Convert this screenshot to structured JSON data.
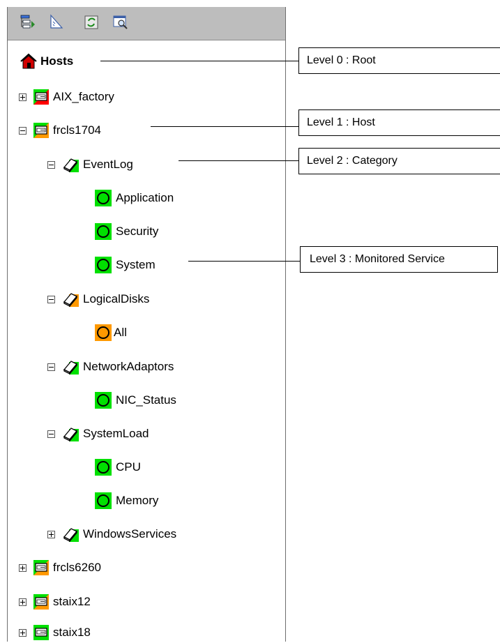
{
  "toolbar": {
    "buttons": [
      {
        "icon": "tree-layout-icon"
      },
      {
        "icon": "ruler-icon"
      },
      {
        "icon": "refresh-icon"
      },
      {
        "icon": "search-window-icon"
      }
    ]
  },
  "tree": {
    "root_label": "Hosts",
    "hosts": [
      {
        "label": "AIX_factory",
        "expanded": false,
        "status_color": "#ff0000"
      },
      {
        "label": "frcls1704",
        "expanded": true,
        "status_color": "#ff9900"
      },
      {
        "label": "frcls6260",
        "expanded": false,
        "status_color": "#ff9900"
      },
      {
        "label": "staix12",
        "expanded": false,
        "status_color": "#ff9900"
      },
      {
        "label": "staix18",
        "expanded": false,
        "status_color": "#00e000"
      }
    ],
    "categories": [
      {
        "label": "EventLog",
        "expanded": true,
        "status_color": "#00e000"
      },
      {
        "label": "LogicalDisks",
        "expanded": true,
        "status_color": "#ff9900"
      },
      {
        "label": "NetworkAdaptors",
        "expanded": true,
        "status_color": "#00e000"
      },
      {
        "label": "SystemLoad",
        "expanded": true,
        "status_color": "#00e000"
      },
      {
        "label": "WindowsServices",
        "expanded": false,
        "status_color": "#00e000"
      }
    ],
    "services": [
      {
        "label": "Application",
        "status_color": "#00e000"
      },
      {
        "label": "Security",
        "status_color": "#00e000"
      },
      {
        "label": "System",
        "status_color": "#00e000"
      },
      {
        "label": "All",
        "status_color": "#ff9900"
      },
      {
        "label": "NIC_Status",
        "status_color": "#00e000"
      },
      {
        "label": "CPU",
        "status_color": "#00e000"
      },
      {
        "label": "Memory",
        "status_color": "#00e000"
      }
    ]
  },
  "callouts": [
    {
      "label": "Level 0 : Root"
    },
    {
      "label": "Level 1 : Host"
    },
    {
      "label": "Level 2 : Category"
    },
    {
      "label": "Level 3 : Monitored Service"
    }
  ],
  "colors": {
    "ok": "#00e000",
    "warning": "#ff9900",
    "critical": "#ff0000",
    "toolbar_bg": "#bdbdbd"
  }
}
